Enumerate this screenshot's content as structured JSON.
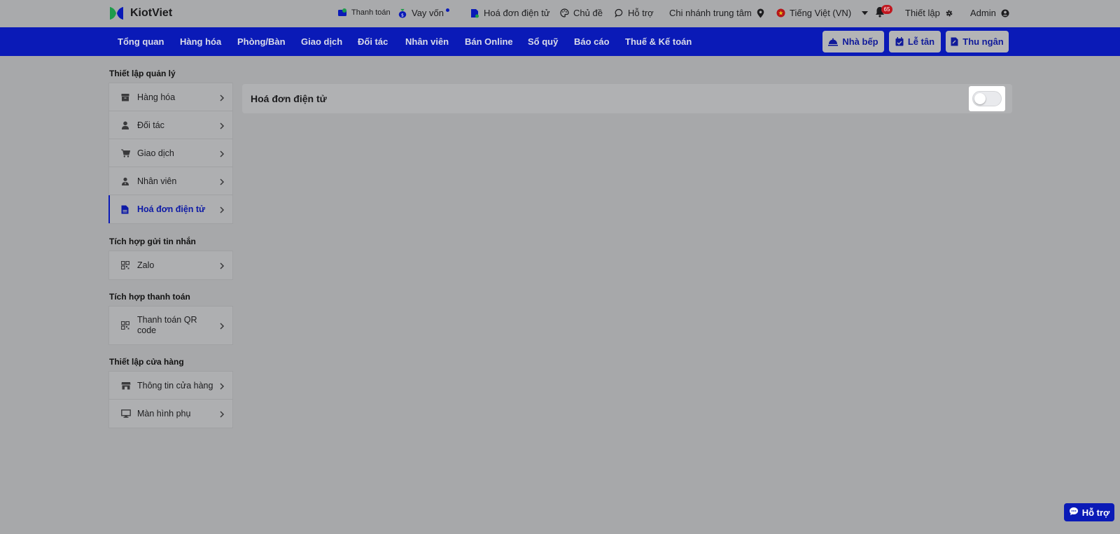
{
  "brand": {
    "name": "KiotViet"
  },
  "topbar": {
    "payment": "Thanh toán",
    "loan": "Vay vốn",
    "einvoice": "Hoá đơn điện tử",
    "theme": "Chủ đề",
    "support": "Hỗ trợ",
    "branch": "Chi nhánh trung tâm",
    "language": "Tiếng Việt (VN)",
    "notifications_count": "65",
    "settings": "Thiết lập",
    "user": "Admin"
  },
  "nav": {
    "items": [
      "Tổng quan",
      "Hàng hóa",
      "Phòng/Bàn",
      "Giao dịch",
      "Đối tác",
      "Nhân viên",
      "Bán Online",
      "Sổ quỹ",
      "Báo cáo",
      "Thuế & Kế toán"
    ],
    "kitchen": "Nhà bếp",
    "reception": "Lễ tân",
    "cashier": "Thu ngân"
  },
  "sidebar": {
    "management_title": "Thiết lập quản lý",
    "management": [
      "Hàng hóa",
      "Đối tác",
      "Giao dịch",
      "Nhân viên",
      "Hoá đơn điện tử"
    ],
    "messaging_title": "Tích hợp gửi tin nhắn",
    "messaging": [
      "Zalo"
    ],
    "payment_title": "Tích hợp thanh toán",
    "payment": [
      "Thanh toán QR code"
    ],
    "store_title": "Thiết lập cửa hàng",
    "store": [
      "Thông tin cửa hàng",
      "Màn hình phụ"
    ]
  },
  "main": {
    "panel_title": "Hoá đơn điện tử",
    "toggle_on": false
  },
  "help": {
    "label": "Hỗ trợ"
  },
  "colors": {
    "primary": "#0a1ab7",
    "badge": "#c1171f",
    "logo_green": "#1e9b4b"
  }
}
